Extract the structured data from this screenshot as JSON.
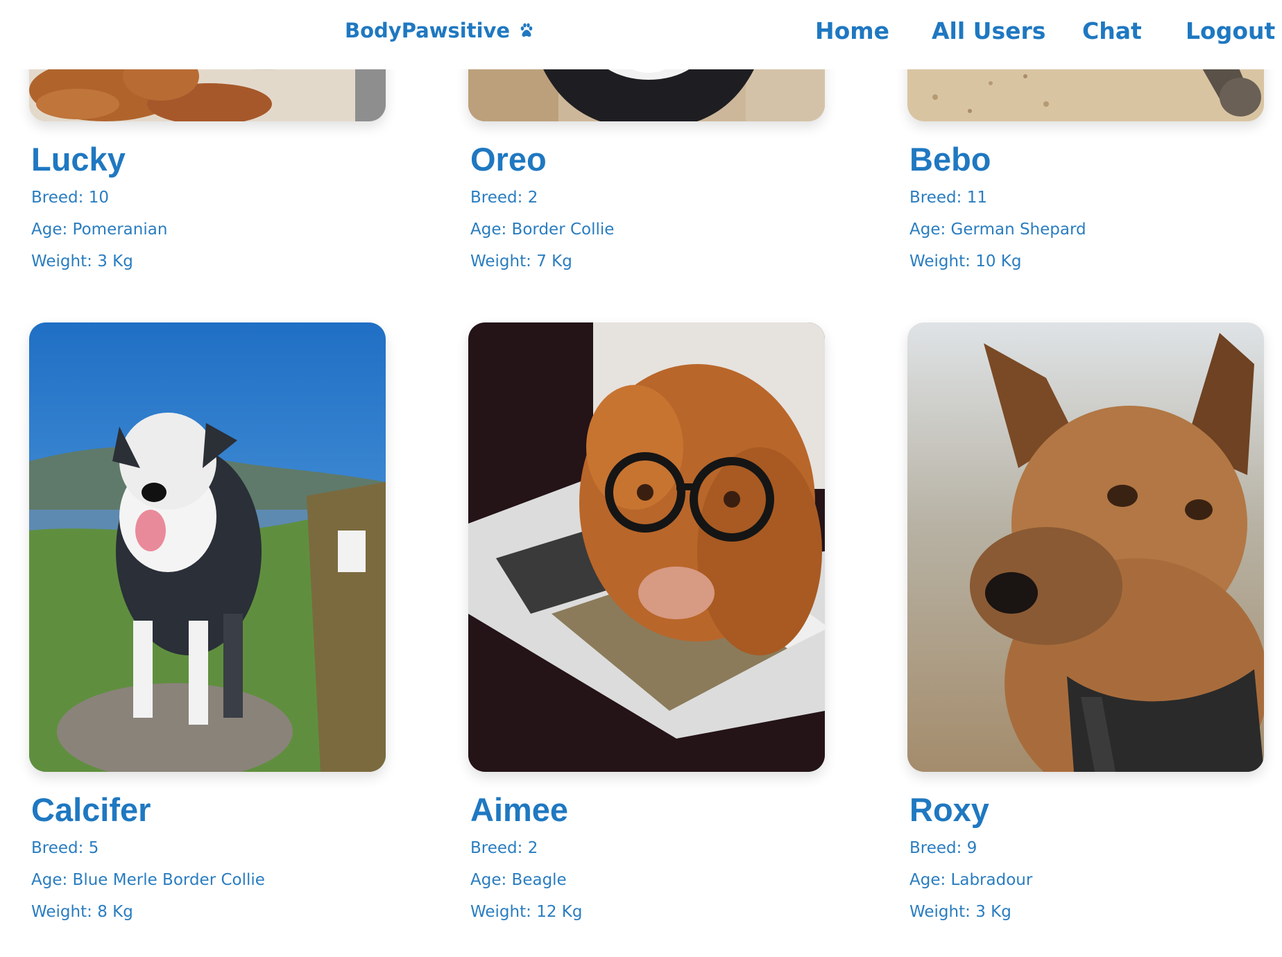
{
  "navbar": {
    "brand": "BodyPawsitive",
    "brand_icon": "paw-icon",
    "links": [
      {
        "label": "Home"
      },
      {
        "label": "All Users"
      },
      {
        "label": "Chat"
      },
      {
        "label": "Logout"
      }
    ]
  },
  "colors": {
    "accent": "#1f78c1",
    "background": "#ffffff"
  },
  "dogs": [
    {
      "name": "Lucky",
      "breed": "Breed: 10",
      "age": "Age: Pomeranian",
      "weight": "Weight: 3 Kg"
    },
    {
      "name": "Oreo",
      "breed": "Breed: 2",
      "age": "Age: Border Collie",
      "weight": "Weight: 7 Kg"
    },
    {
      "name": "Bebo",
      "breed": "Breed: 11",
      "age": "Age: German Shepard",
      "weight": "Weight: 10 Kg"
    },
    {
      "name": "Calcifer",
      "breed": "Breed: 5",
      "age": "Age: Blue Merle Border Collie",
      "weight": "Weight: 8 Kg"
    },
    {
      "name": "Aimee",
      "breed": "Breed: 2",
      "age": "Age: Beagle",
      "weight": "Weight: 12 Kg"
    },
    {
      "name": "Roxy",
      "breed": "Breed: 9",
      "age": "Age: Labradour",
      "weight": "Weight: 3 Kg"
    }
  ]
}
